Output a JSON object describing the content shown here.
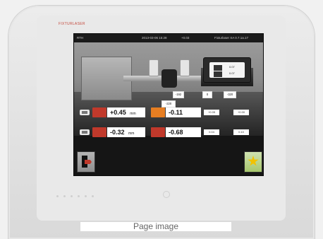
{
  "brand": {
    "logo_text": "FIXTURLASER"
  },
  "screen": {
    "status": {
      "left": "RTH",
      "date_time": "2013-03-06  15:28",
      "middle_value": "+0.03",
      "right_text": "Fixturlaser XA  0.7.1a.17"
    },
    "scene": {
      "feet_labels": [
        "-192",
        "0",
        "-320"
      ],
      "shaft_label": "-220",
      "info_values": [
        "0.07",
        "0.07"
      ]
    },
    "rows": [
      {
        "badge_color": "#c0392b",
        "value": "+0.45",
        "unit": "mm",
        "badge2_color": "#e67e22",
        "value2": "-0.11",
        "tol1": "+0.05",
        "tol2": "+0.00"
      },
      {
        "badge_color": "#c0392b",
        "value": "-0.32",
        "unit": "mm",
        "badge2_color": "#c0392b",
        "value2": "-0.68",
        "tol1": "0.04",
        "tol2": "0.10"
      }
    ],
    "buttons": {
      "exit_icon": "exit-door-icon",
      "result_icon": "star-icon"
    }
  },
  "footer_label": "Page image"
}
